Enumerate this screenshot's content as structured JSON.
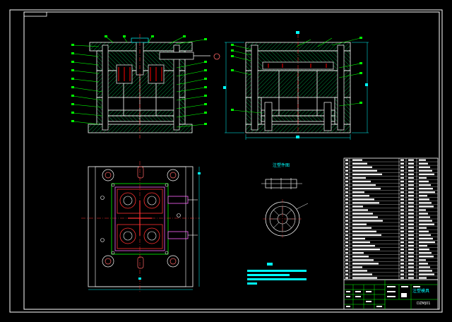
{
  "drawing": {
    "background": "#000000",
    "line_color": "#ffffff",
    "annotation_color": "#00ff00",
    "dimension_color": "#00ffff",
    "hatch_color": "#00ff66",
    "centerline_color": "#ff3030",
    "part_color": "#ff0000",
    "accent_color": "#ff66ff"
  },
  "insert_view": {
    "title": "注塑件图"
  },
  "title_block": {
    "school": "注塑模具",
    "drawing_number": "DZMJ01"
  },
  "parts_list": {
    "row_count": 34
  }
}
